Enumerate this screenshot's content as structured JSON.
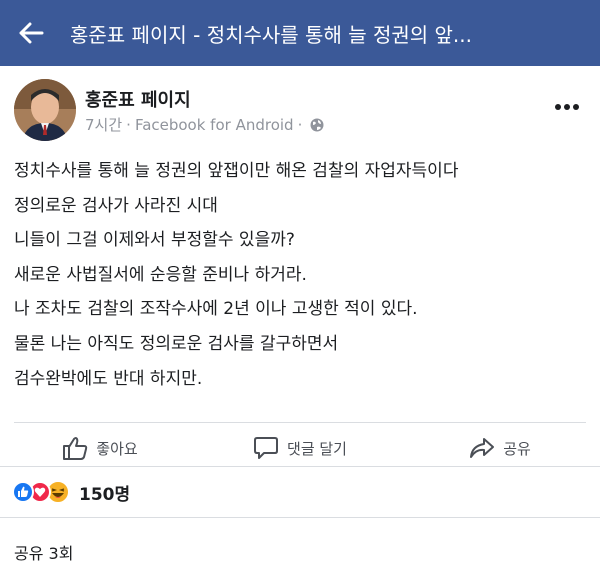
{
  "topbar": {
    "title": "홍준표 페이지 - 정치수사를 통해 늘 정권의 앞...",
    "accent": "#3b5998"
  },
  "post": {
    "page_name": "홍준표 페이지",
    "time": "7시간",
    "separator": "·",
    "source": "Facebook for Android",
    "visibility_icon": "globe-icon",
    "lines": [
      "정치수사를 통해 늘 정권의 앞잽이만 해온 검찰의 자업자득이다",
      "정의로운 검사가 사라진 시대",
      "니들이 그걸 이제와서 부정할수 있을까?",
      "새로운 사법질서에 순응할 준비나 하거라.",
      "나 조차도 검찰의 조작수사에 2년 이나 고생한 적이 있다.",
      "물론 나는 아직도 정의로운 검사를 갈구하면서",
      "검수완박에도 반대 하지만."
    ]
  },
  "actions": {
    "like": "좋아요",
    "comment": "댓글 달기",
    "share": "공유"
  },
  "reactions": {
    "icons": [
      "like-reaction-icon",
      "love-reaction-icon",
      "haha-reaction-icon"
    ],
    "count": "150명"
  },
  "shares": {
    "text": "공유 3회"
  }
}
